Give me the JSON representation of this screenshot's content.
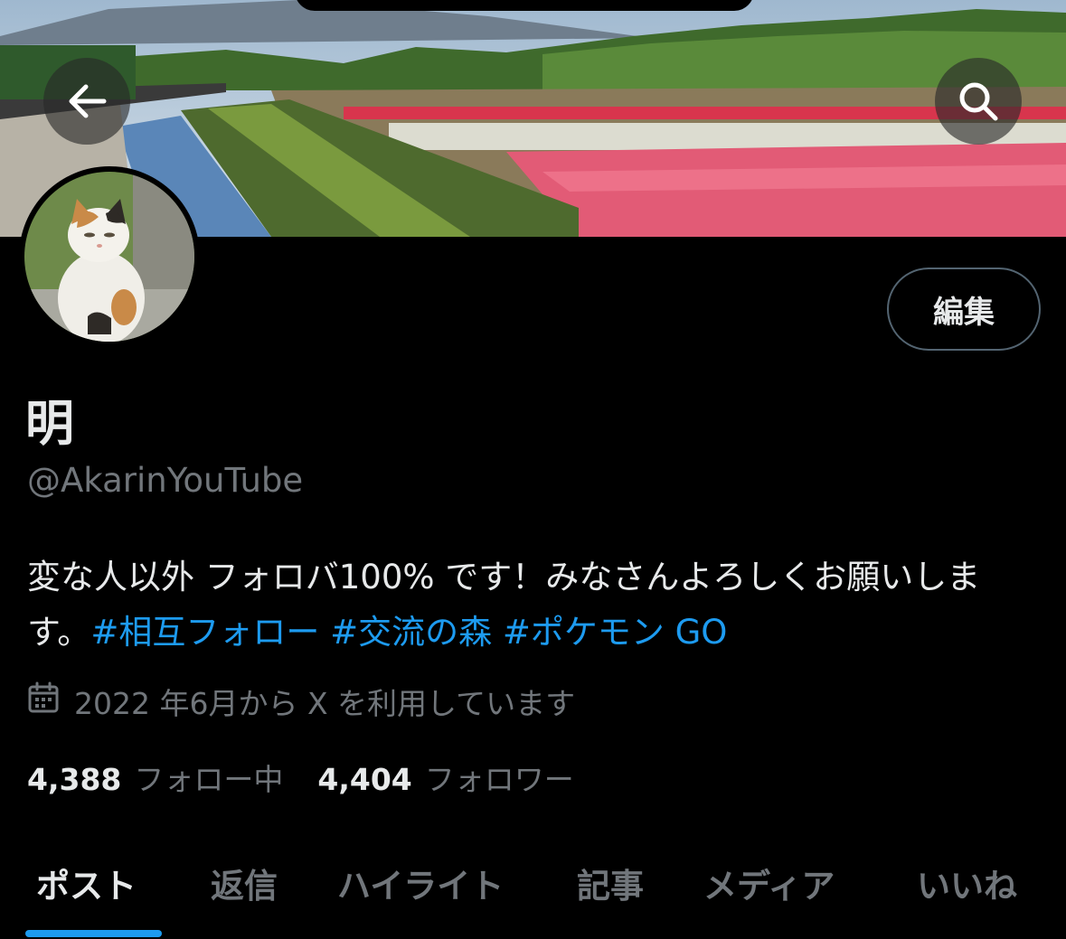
{
  "header": {
    "back_icon": "arrow-left-icon",
    "search_icon": "search-icon"
  },
  "profile": {
    "display_name": "明",
    "handle": "@AkarinYouTube",
    "edit_label": "編集",
    "bio_text": "変な人以外 フォロバ100% です！みなさんよろしくお願いします。",
    "hashtags": [
      "#相互フォロー",
      "#交流の森",
      "#ポケモン GO"
    ],
    "joined_icon": "calendar-icon",
    "joined_text": "2022 年6月から X を利用しています",
    "following_count": "4,388",
    "following_label": "フォロー中",
    "followers_count": "4,404",
    "followers_label": "フォロワー"
  },
  "tabs": [
    {
      "label": "ポスト",
      "active": true
    },
    {
      "label": "返信",
      "active": false
    },
    {
      "label": "ハイライト",
      "active": false
    },
    {
      "label": "記事",
      "active": false
    },
    {
      "label": "メディア",
      "active": false
    },
    {
      "label": "いいね",
      "active": false
    }
  ],
  "colors": {
    "background": "#000000",
    "accent": "#1d9bf0",
    "secondary_text": "#71767b",
    "primary_text": "#e7e9ea"
  }
}
